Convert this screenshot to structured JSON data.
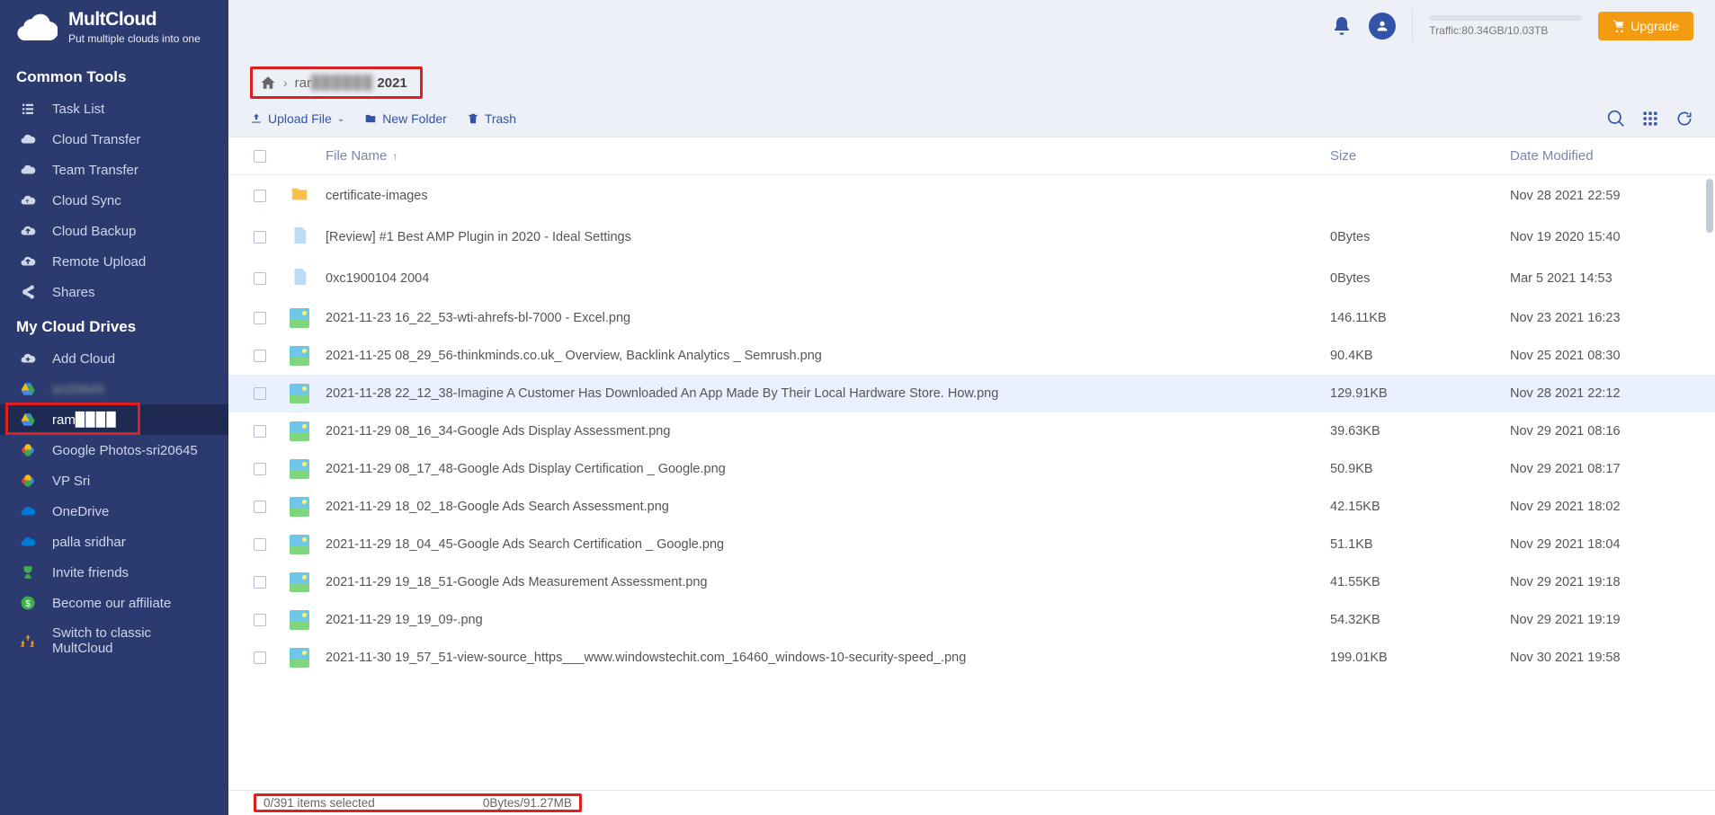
{
  "brand": {
    "name": "MultCloud",
    "tagline": "Put multiple clouds into one"
  },
  "sidebar": {
    "common_title": "Common Tools",
    "common": [
      {
        "label": "Task List",
        "icon": "list"
      },
      {
        "label": "Cloud Transfer",
        "icon": "cloud"
      },
      {
        "label": "Team Transfer",
        "icon": "cloud"
      },
      {
        "label": "Cloud Sync",
        "icon": "cloud-sync"
      },
      {
        "label": "Cloud Backup",
        "icon": "cloud-up"
      },
      {
        "label": "Remote Upload",
        "icon": "cloud-up"
      },
      {
        "label": "Shares",
        "icon": "share"
      }
    ],
    "drives_title": "My Cloud Drives",
    "drives": [
      {
        "label": "Add Cloud",
        "icon": "add-cloud"
      },
      {
        "label": "sri20645",
        "icon": "gdrive",
        "blur": true
      },
      {
        "label": "ram▉▉▉▉",
        "icon": "gdrive",
        "active": true,
        "boxed": true
      },
      {
        "label": "Google Photos-sri20645",
        "icon": "gphotos"
      },
      {
        "label": "VP Sri",
        "icon": "gphotos"
      },
      {
        "label": "OneDrive",
        "icon": "onedrive"
      },
      {
        "label": "palla  sridhar",
        "icon": "onedrive"
      },
      {
        "label": "Invite friends",
        "icon": "trophy"
      },
      {
        "label": "Become our affiliate",
        "icon": "dollar"
      },
      {
        "label": "Switch to classic MultCloud",
        "icon": "recycle"
      }
    ]
  },
  "topbar": {
    "traffic": "Traffic:80.34GB/10.03TB",
    "upgrade": "Upgrade"
  },
  "breadcrumb": {
    "path1": "rar",
    "path2_blur": "▉▉▉▉▉▉",
    "path3": "2021"
  },
  "toolbar": {
    "upload": "Upload File",
    "newfolder": "New Folder",
    "trash": "Trash"
  },
  "columns": {
    "name": "File Name",
    "size": "Size",
    "date": "Date Modified"
  },
  "rows": [
    {
      "type": "folder",
      "name": "certificate-images",
      "size": "",
      "date": "Nov 28 2021 22:59"
    },
    {
      "type": "file",
      "name": "[Review] #1 Best AMP Plugin in 2020 - Ideal Settings",
      "size": "0Bytes",
      "date": "Nov 19 2020 15:40"
    },
    {
      "type": "file",
      "name": "0xc1900104 2004",
      "size": "0Bytes",
      "date": "Mar 5 2021 14:53"
    },
    {
      "type": "img",
      "name": "2021-11-23 16_22_53-wti-ahrefs-bl-7000 - Excel.png",
      "size": "146.11KB",
      "date": "Nov 23 2021 16:23"
    },
    {
      "type": "img",
      "name": "2021-11-25 08_29_56-thinkminds.co.uk_ Overview, Backlink Analytics _ Semrush.png",
      "size": "90.4KB",
      "date": "Nov 25 2021 08:30"
    },
    {
      "type": "img",
      "name": "2021-11-28 22_12_38-Imagine A Customer Has Downloaded An App Made By Their Local Hardware Store. How.png",
      "size": "129.91KB",
      "date": "Nov 28 2021 22:12",
      "hl": true
    },
    {
      "type": "img",
      "name": "2021-11-29 08_16_34-Google Ads Display Assessment.png",
      "size": "39.63KB",
      "date": "Nov 29 2021 08:16"
    },
    {
      "type": "img",
      "name": "2021-11-29 08_17_48-Google Ads Display Certification _ Google.png",
      "size": "50.9KB",
      "date": "Nov 29 2021 08:17"
    },
    {
      "type": "img",
      "name": "2021-11-29 18_02_18-Google Ads Search Assessment.png",
      "size": "42.15KB",
      "date": "Nov 29 2021 18:02"
    },
    {
      "type": "img",
      "name": "2021-11-29 18_04_45-Google Ads Search Certification _ Google.png",
      "size": "51.1KB",
      "date": "Nov 29 2021 18:04"
    },
    {
      "type": "img",
      "name": "2021-11-29 19_18_51-Google Ads Measurement Assessment.png",
      "size": "41.55KB",
      "date": "Nov 29 2021 19:18"
    },
    {
      "type": "img",
      "name": "2021-11-29 19_19_09-.png",
      "size": "54.32KB",
      "date": "Nov 29 2021 19:19"
    },
    {
      "type": "img",
      "name": "2021-11-30 19_57_51-view-source_https___www.windowstechit.com_16460_windows-10-security-speed_.png",
      "size": "199.01KB",
      "date": "Nov 30 2021 19:58"
    }
  ],
  "status": {
    "selected": "0/391 items selected",
    "size": "0Bytes/91.27MB"
  }
}
